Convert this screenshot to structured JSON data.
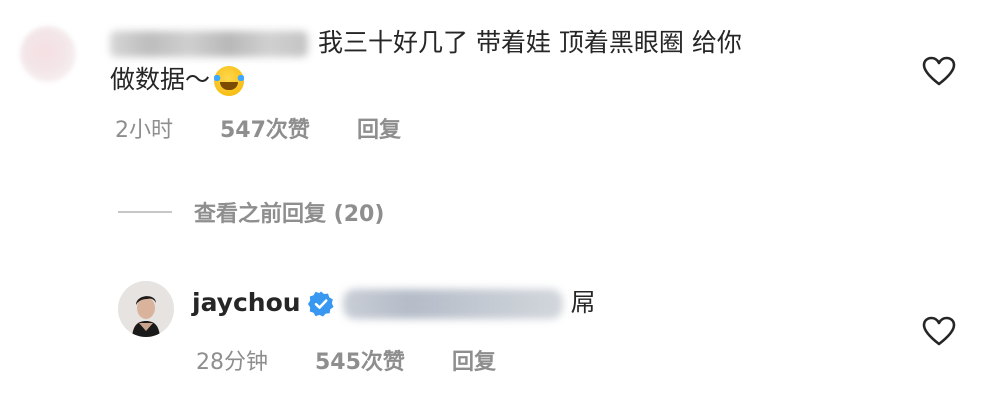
{
  "comment1": {
    "text_line1": "我三十好几了 带着娃 顶着黑眼圈 给你",
    "text_line2": "做数据～",
    "emoji": "face-with-tears-of-joy",
    "time": "2小时",
    "likes": "547次赞",
    "reply": "回复"
  },
  "view_previous_replies": "查看之前回复 (20)",
  "comment2": {
    "username": "jaychou",
    "text": "屌",
    "time": "28分钟",
    "likes": "545次赞",
    "reply": "回复"
  },
  "colors": {
    "text": "#262626",
    "secondary": "#8e8e8e",
    "verified": "#3897f0"
  }
}
